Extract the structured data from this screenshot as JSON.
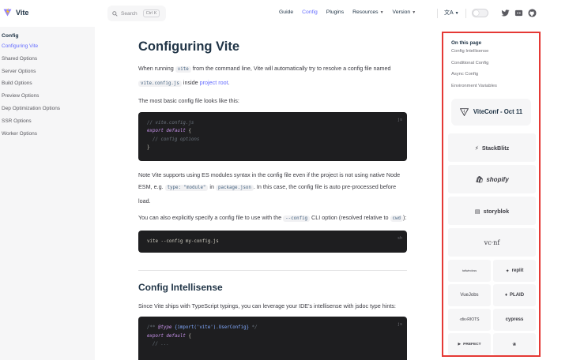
{
  "brand": {
    "name": "Vite",
    "logo_icon": "vite-logo-icon"
  },
  "search": {
    "label": "Search",
    "shortcut": "Ctrl K"
  },
  "nav": {
    "items": [
      {
        "label": "Guide"
      },
      {
        "label": "Config",
        "active": true
      },
      {
        "label": "Plugins"
      },
      {
        "label": "Resources",
        "dropdown": true
      },
      {
        "label": "Version",
        "dropdown": true
      }
    ],
    "translate_icon": "translate-icon",
    "theme_toggle": "appearance-toggle",
    "social": [
      "twitter-icon",
      "discord-icon",
      "github-icon"
    ]
  },
  "sidebar": {
    "title": "Config",
    "items": [
      {
        "label": "Configuring Vite",
        "active": true
      },
      {
        "label": "Shared Options"
      },
      {
        "label": "Server Options"
      },
      {
        "label": "Build Options"
      },
      {
        "label": "Preview Options"
      },
      {
        "label": "Dep Optimization Options"
      },
      {
        "label": "SSR Options"
      },
      {
        "label": "Worker Options"
      }
    ]
  },
  "doc": {
    "title": "Configuring Vite",
    "p1": {
      "a": "When running ",
      "code1": "vite",
      "b": " from the command line, Vite will automatically try to resolve a config file named ",
      "code2": "vite.config.js",
      "c": " inside ",
      "link": "project root",
      "d": "."
    },
    "p2": "The most basic config file looks like this:",
    "code1": {
      "lang": "js",
      "line1": "// vite.config.js",
      "line2_kw": "export default",
      "line2_rest": " {",
      "line3": "  // config options",
      "line4": "}"
    },
    "p3": {
      "a": "Note Vite supports using ES modules syntax in the config file even if the project is not using native Node ESM, e.g. ",
      "code1": "type: \"module\"",
      "b": " in ",
      "code2": "package.json",
      "c": ". In this case, the config file is auto pre-processed before load."
    },
    "p4": {
      "a": "You can also explicitly specify a config file to use with the ",
      "code1": "--config",
      "b": " CLI option (resolved relative to ",
      "code2": "cwd",
      "c": "):"
    },
    "code2": {
      "lang": "sh",
      "line1": "vite --config my-config.js"
    },
    "h2": "Config Intellisense",
    "p5": "Since Vite ships with TypeScript typings, you can leverage your IDE's intellisense with jsdoc type hints:",
    "code3": {
      "lang": "js",
      "c_open": "/** ",
      "c_tag": "@type",
      "c_type": " {import('vite').UserConfig}",
      "c_close": " */",
      "line2_kw": "export default",
      "line2_rest": " {",
      "line3": "  // ..."
    }
  },
  "aside": {
    "toc_title": "On this page",
    "toc": [
      {
        "label": "Config Intellisense"
      },
      {
        "label": "Conditional Config"
      },
      {
        "label": "Async Config"
      },
      {
        "label": "Environment Variables"
      }
    ],
    "conf_label": "ViteConf - Oct 11",
    "sponsors": {
      "stackblitz": "StackBlitz",
      "shopify": "shopify",
      "storyblok": "storyblok",
      "vcnf": "vc·nf",
      "tailwind": "tailwindcss",
      "replit": "replit",
      "vuejobs": "VueJobs",
      "plaid": "PLAID",
      "divriots": "‹div›RIOTS",
      "cypress": "cypress",
      "prefect": "PREFECT"
    }
  },
  "colors": {
    "accent": "#646cff",
    "highlight": "#e53935"
  }
}
